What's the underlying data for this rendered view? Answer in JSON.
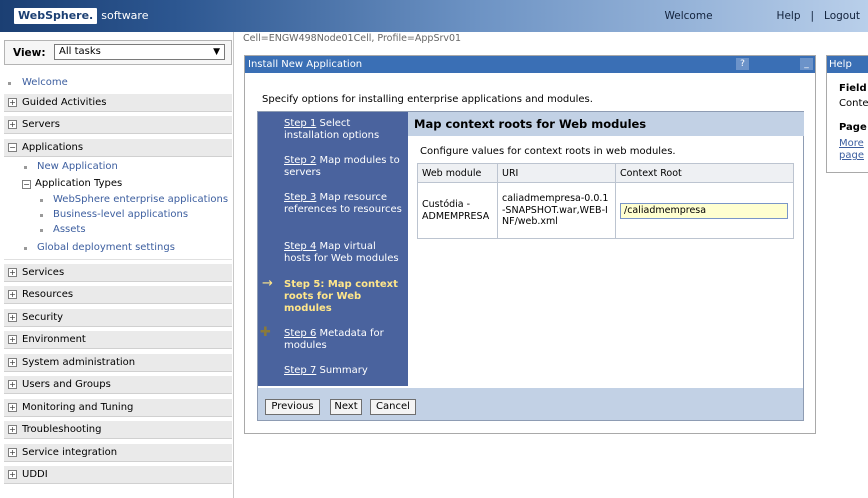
{
  "banner": {
    "logo_brand": "WebSphere.",
    "logo_suffix": "software",
    "welcome": "Welcome",
    "help": "Help",
    "separator": "|",
    "logout": "Logout"
  },
  "nav": {
    "view_label": "View:",
    "view_value": "All tasks",
    "welcome": "Welcome",
    "items": [
      {
        "label": "Guided Activities",
        "expanded": false
      },
      {
        "label": "Servers",
        "expanded": false
      },
      {
        "label": "Applications",
        "expanded": true
      },
      {
        "label": "Services",
        "expanded": false
      },
      {
        "label": "Resources",
        "expanded": false
      },
      {
        "label": "Security",
        "expanded": false
      },
      {
        "label": "Environment",
        "expanded": false
      },
      {
        "label": "System administration",
        "expanded": false
      },
      {
        "label": "Users and Groups",
        "expanded": false
      },
      {
        "label": "Monitoring and Tuning",
        "expanded": false
      },
      {
        "label": "Troubleshooting",
        "expanded": false
      },
      {
        "label": "Service integration",
        "expanded": false
      },
      {
        "label": "UDDI",
        "expanded": false
      }
    ],
    "applications": {
      "new_application": "New Application",
      "application_types": "Application Types",
      "types": [
        "WebSphere enterprise applications",
        "Business-level applications",
        "Assets"
      ],
      "global_deployment": "Global deployment settings"
    }
  },
  "cell_info": "Cell=ENGW498Node01Cell, Profile=AppSrv01",
  "panel": {
    "title": "Install New Application",
    "help_btn": "?",
    "min_btn": "_",
    "intro": "Specify options for installing enterprise applications and modules."
  },
  "steps": [
    {
      "num": "Step 1",
      "text": "Select installation options",
      "current": false
    },
    {
      "num": "Step 2",
      "text": "Map modules to servers",
      "current": false
    },
    {
      "num": "Step 3",
      "text": "Map resource references to resources",
      "current": false
    },
    {
      "num": "Step 4",
      "text": "Map virtual hosts for Web modules",
      "current": false
    },
    {
      "num": "Step 5:",
      "text": "Map context roots for Web modules",
      "current": true
    },
    {
      "num": "Step 6",
      "text": "Metadata for modules",
      "current": false
    },
    {
      "num": "Step 7",
      "text": "Summary",
      "current": false
    }
  ],
  "step_content": {
    "heading": "Map context roots for Web modules",
    "description": "Configure values for context roots in web modules.",
    "columns": [
      "Web module",
      "URI",
      "Context Root"
    ],
    "rows": [
      {
        "web_module": "Custódia - ADMEMPRESA",
        "uri": "caliadmempresa-0.0.1-SNAPSHOT.war,WEB-INF/web.xml",
        "context_root": "/caliadmempresa"
      }
    ]
  },
  "buttons": {
    "previous": "Previous",
    "next": "Next",
    "cancel": "Cancel"
  },
  "help_panel": {
    "title": "Help",
    "field_heading": "Field",
    "field_text": "Conte",
    "page_heading": "Page",
    "more_link_1": "More",
    "more_link_2": "page"
  }
}
